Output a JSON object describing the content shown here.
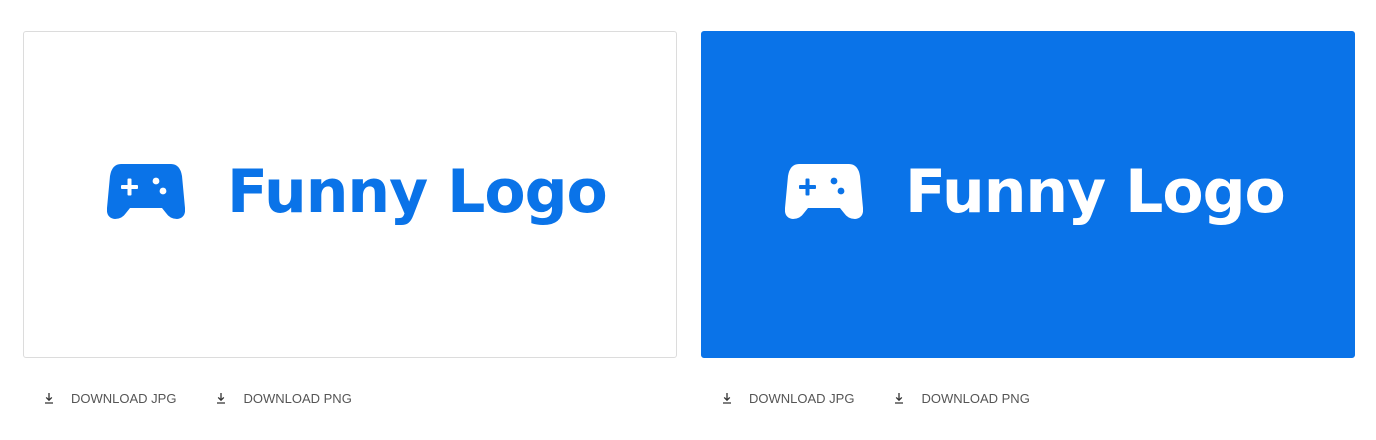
{
  "colors": {
    "brand_blue": "#0a73e8",
    "white": "#ffffff",
    "card_border": "#dcdcdc",
    "link_text": "#555555"
  },
  "icons": {
    "logo": "gamepad-icon",
    "download": "download-icon"
  },
  "previews": [
    {
      "variant": "light",
      "background": "#ffffff",
      "logo_color": "#0a73e8",
      "brand_text": "Funny Logo",
      "downloads": [
        {
          "label": "DOWNLOAD JPG"
        },
        {
          "label": "DOWNLOAD PNG"
        }
      ]
    },
    {
      "variant": "dark",
      "background": "#0a73e8",
      "logo_color": "#ffffff",
      "brand_text": "Funny Logo",
      "downloads": [
        {
          "label": "DOWNLOAD JPG"
        },
        {
          "label": "DOWNLOAD PNG"
        }
      ]
    }
  ]
}
